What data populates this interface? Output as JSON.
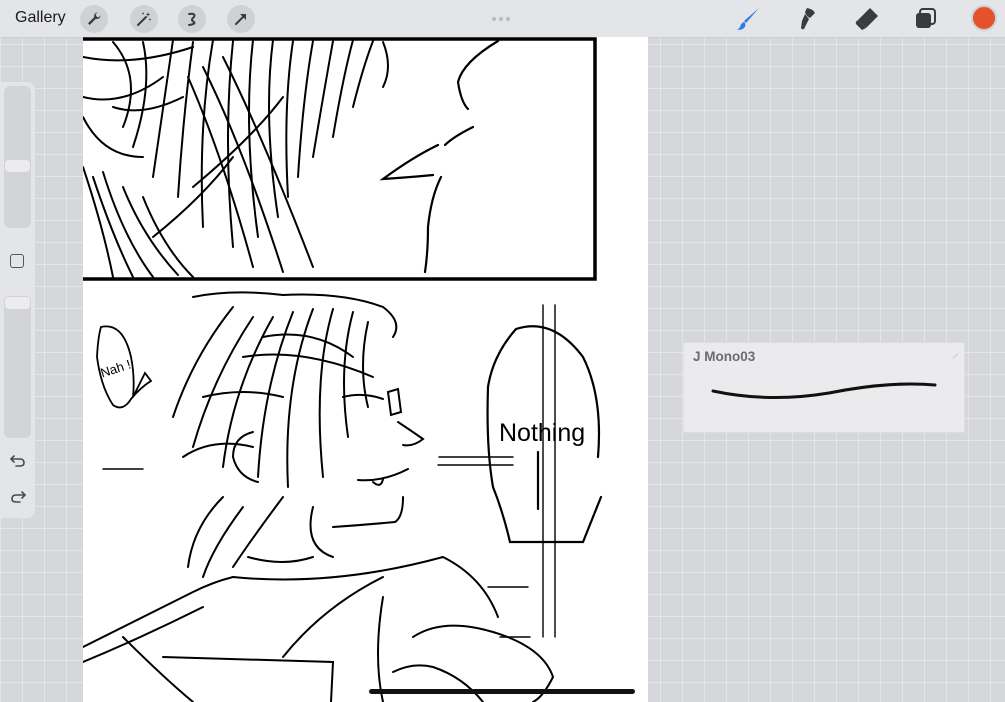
{
  "toolbar": {
    "gallery_label": "Gallery",
    "left_tools": [
      {
        "icon": "wrench-icon",
        "label": "Actions"
      },
      {
        "icon": "magic-wand-icon",
        "label": "Adjustments"
      },
      {
        "icon": "selection-icon",
        "label": "Selection"
      },
      {
        "icon": "transform-arrow-icon",
        "label": "Transform"
      }
    ],
    "right_tools": [
      {
        "icon": "brush-icon",
        "active": true
      },
      {
        "icon": "smudge-icon",
        "active": false
      },
      {
        "icon": "eraser-icon",
        "active": false
      },
      {
        "icon": "layers-icon",
        "active": false
      }
    ],
    "current_color": "#e4512b",
    "active_tool_color": "#2f79e8"
  },
  "sidebar": {
    "brush_size_level": 0.42,
    "opacity_level": 1.0,
    "icons": [
      "modify-square-icon",
      "undo-icon",
      "redo-icon"
    ]
  },
  "canvas": {
    "speech_bubble_text": "Nah !",
    "sign_text": "Nothing"
  },
  "brush_panel": {
    "brush_name": "J Mono03",
    "icon": "brush-library-icon"
  }
}
